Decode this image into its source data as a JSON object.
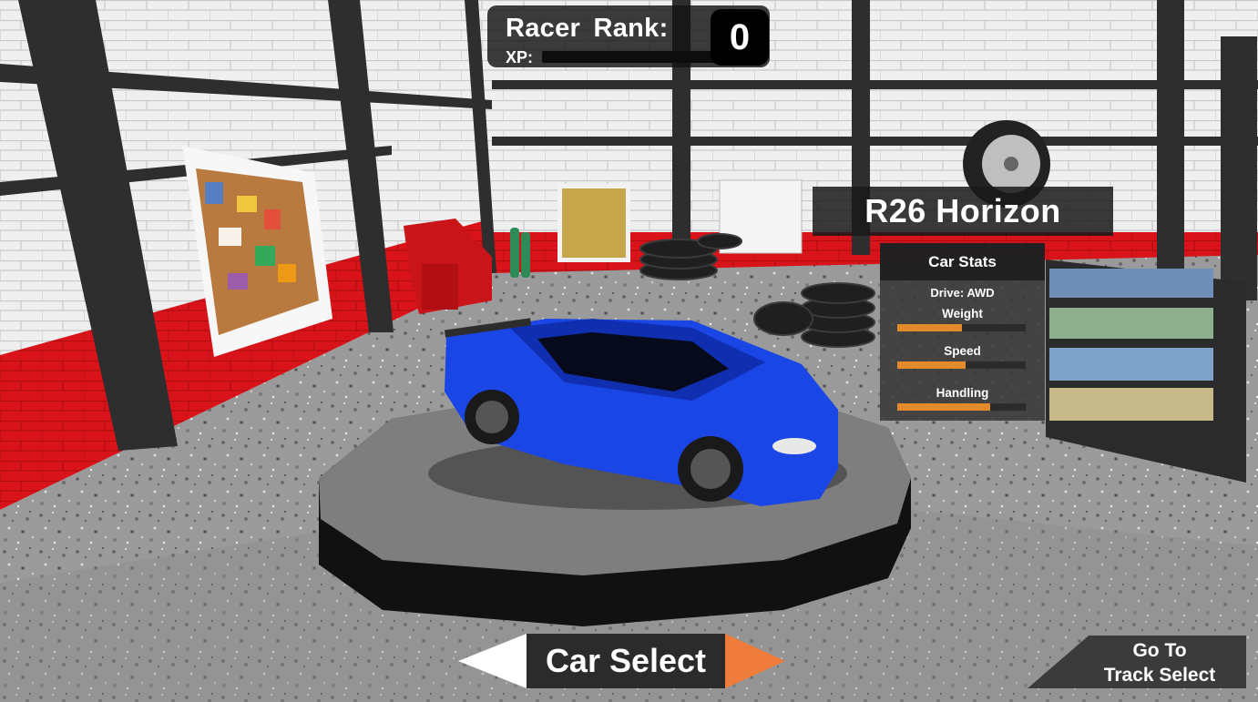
{
  "hud": {
    "rank_label": "Racer  Rank:",
    "rank_value": "0",
    "xp_label": "XP:",
    "xp_progress": 0
  },
  "car": {
    "name": "R26 Horizon",
    "color": "#1a46e6"
  },
  "stats": {
    "title": "Car Stats",
    "drive": "Drive:  AWD",
    "items": [
      {
        "label": "Weight",
        "value": 0.5
      },
      {
        "label": "Speed",
        "value": 0.53
      },
      {
        "label": "Handling",
        "value": 0.72
      }
    ]
  },
  "nav": {
    "car_select_label": "Car Select",
    "track_select_line1": "Go To",
    "track_select_line2": "Track Select"
  },
  "colors": {
    "accent_orange": "#e38a2b",
    "arrow_right": "#ef7c3b",
    "wall_red": "#d8141a"
  }
}
